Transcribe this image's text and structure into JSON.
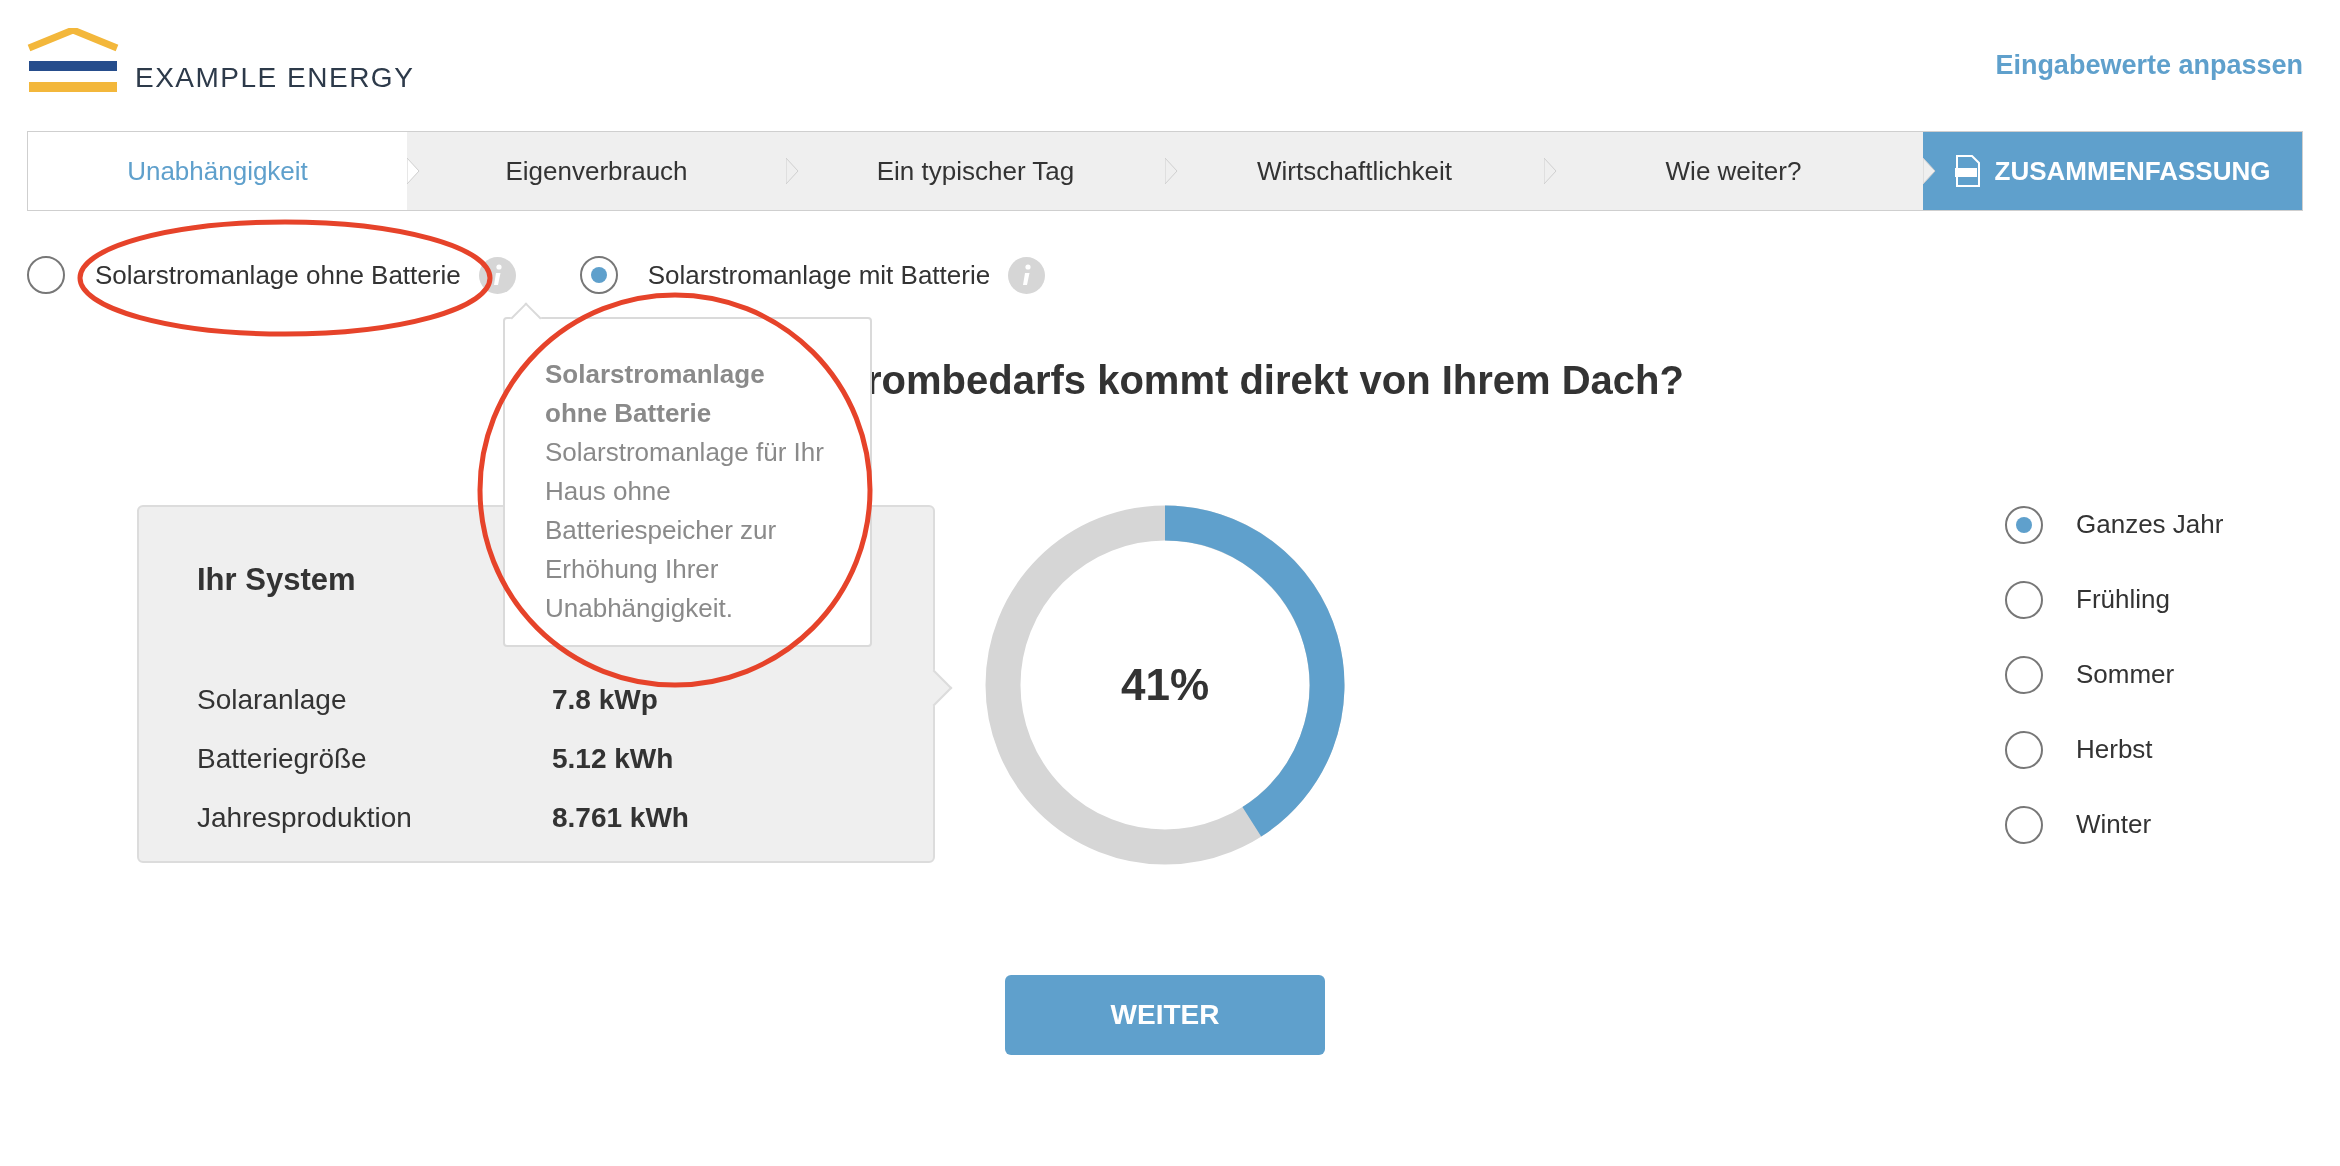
{
  "header": {
    "logo_text": "EXAMPLE ENERGY",
    "link": "Eingabewerte anpassen"
  },
  "tabs": [
    {
      "label": "Unabhängigkeit",
      "selected": true,
      "kind": "step"
    },
    {
      "label": "Eigenverbrauch",
      "selected": false,
      "kind": "step"
    },
    {
      "label": "Ein typischer Tag",
      "selected": false,
      "kind": "step"
    },
    {
      "label": "Wirtschaftlichkeit",
      "selected": false,
      "kind": "step"
    },
    {
      "label": "Wie weiter?",
      "selected": false,
      "kind": "step"
    },
    {
      "label": "ZUSAMMENFASSUNG",
      "selected": false,
      "kind": "summary"
    }
  ],
  "system_options": [
    {
      "label": "Solarstromanlage ohne Batterie",
      "selected": false
    },
    {
      "label": "Solarstromanlage mit Batterie",
      "selected": true
    }
  ],
  "tooltip": {
    "title": "Solarstromanlage ohne Batterie",
    "text": "Solarstromanlage für Ihr Haus ohne Batteriespeicher zur Erhöhung Ihrer Unabhängigkeit."
  },
  "heading": "rombedarfs kommt direkt von Ihrem Dach?",
  "system_panel": {
    "title": "Ihr System",
    "rows": [
      {
        "label": "Solaranlage",
        "value": "7.8 kWp"
      },
      {
        "label": "Batteriegröße",
        "value": "5.12 kWh"
      },
      {
        "label": "Jahresproduktion",
        "value": "8.761 kWh"
      }
    ]
  },
  "donut": {
    "label": "41%"
  },
  "seasons": [
    {
      "label": "Ganzes Jahr",
      "selected": true
    },
    {
      "label": "Frühling",
      "selected": false
    },
    {
      "label": "Sommer",
      "selected": false
    },
    {
      "label": "Herbst",
      "selected": false
    },
    {
      "label": "Winter",
      "selected": false
    }
  ],
  "button": "WEITER",
  "annotations": [
    {
      "kind": "ellipse"
    },
    {
      "kind": "circle"
    }
  ]
}
